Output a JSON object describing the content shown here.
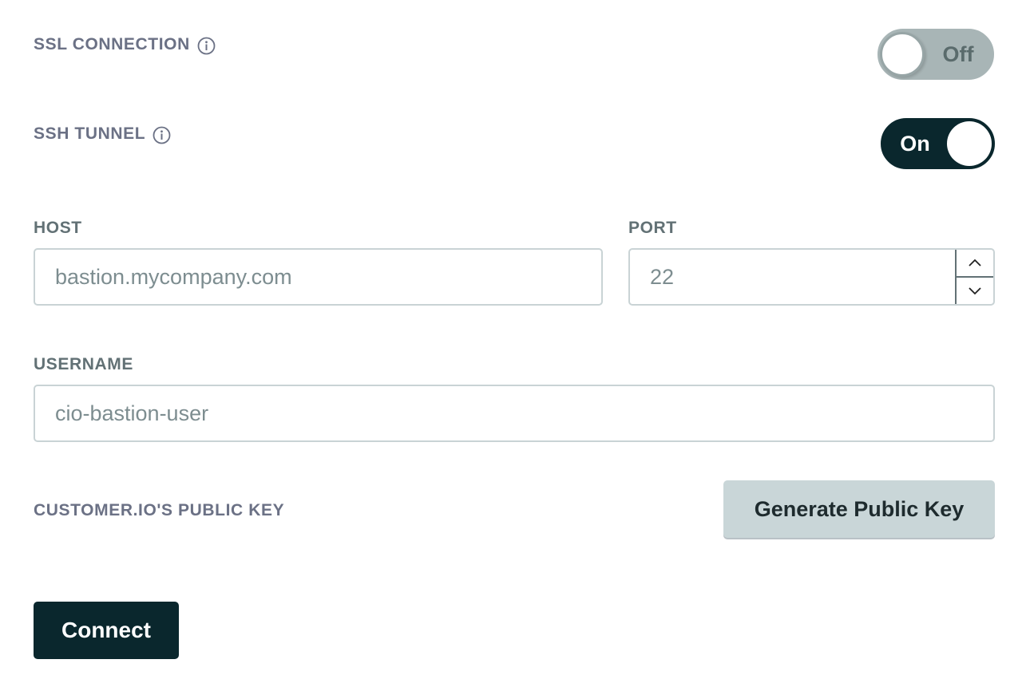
{
  "ssl": {
    "label": "SSL CONNECTION",
    "info_icon": "info-circle-icon",
    "toggle_state": "off",
    "toggle_text": "Off"
  },
  "ssh": {
    "label": "SSH TUNNEL",
    "info_icon": "info-circle-icon",
    "toggle_state": "on",
    "toggle_text": "On"
  },
  "host": {
    "label": "HOST",
    "placeholder": "bastion.mycompany.com",
    "value": ""
  },
  "port": {
    "label": "PORT",
    "placeholder": "22",
    "value": "",
    "increment_icon": "chevron-up-icon",
    "decrement_icon": "chevron-down-icon"
  },
  "username": {
    "label": "USERNAME",
    "placeholder": "cio-bastion-user",
    "value": ""
  },
  "public_key": {
    "label": "CUSTOMER.IO'S PUBLIC KEY",
    "button_label": "Generate Public Key"
  },
  "actions": {
    "connect_label": "Connect"
  },
  "colors": {
    "primary": "#0a272d",
    "toggle_off": "#a8b5b6",
    "secondary_button": "#c9d6d8",
    "label_muted": "#6b7185"
  }
}
